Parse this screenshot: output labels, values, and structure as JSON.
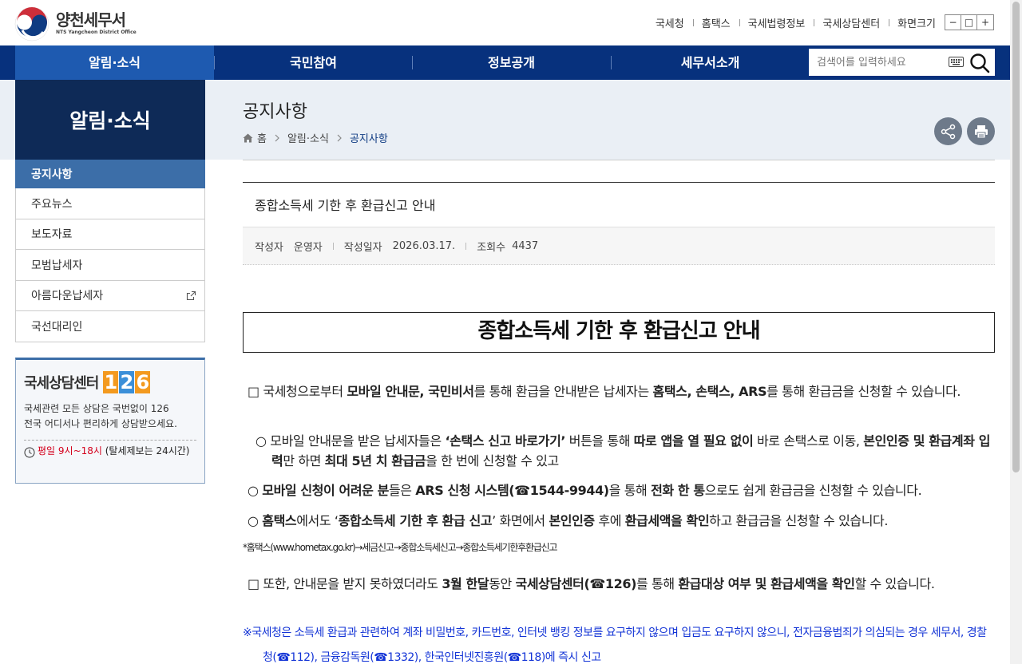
{
  "header": {
    "logo_title": "양천세무서",
    "logo_subtitle": "NTS Yangcheon District Office",
    "util_links": [
      "국세청",
      "홈택스",
      "국세법령정보",
      "국세상담센터",
      "화면크기"
    ],
    "font_buttons": [
      "−",
      "□",
      "+"
    ]
  },
  "gnb": {
    "items": [
      "알림·소식",
      "국민참여",
      "정보공개",
      "세무서소개"
    ],
    "search_placeholder": "검색어를 입력하세요"
  },
  "lnb": {
    "title": "알림·소식",
    "items": [
      "공지사항",
      "주요뉴스",
      "보도자료",
      "모범납세자",
      "아름다운납세자",
      "국선대리인"
    ]
  },
  "consult": {
    "title": "국세상담센터",
    "number_digits": [
      "1",
      "2",
      "6"
    ],
    "desc_line1": "국세관련 모든 상담은 국번없이 126",
    "desc_line2": "전국 어디서나 편리하게 상담받으세요.",
    "time_red": "평일 9시~18시",
    "time_note": " (탈세제보는 24시간)"
  },
  "page": {
    "title": "공지사항",
    "breadcrumb": [
      "홈",
      "알림·소식",
      "공지사항"
    ]
  },
  "post": {
    "title": "종합소득세 기한 후 환급신고 안내",
    "author_label": "작성자",
    "author": "운영자",
    "date_label": "작성일자",
    "date": "2026.03.17.",
    "views_label": "조회수",
    "views": "4437",
    "doc_title": "종합소득세 기한 후 환급신고 안내",
    "hometax_path": "*홈택스(www.hometax.go.kr)→세금신고→종합소득세신고→종합소득세기한후환급신고"
  },
  "colors": {
    "gnb_bg": "#07317d",
    "gnb_active": "#1e5ab0",
    "lnb_title_bg": "#0e2a57",
    "lnb_active": "#3c6ea8",
    "warning_text": "#1233d6"
  }
}
